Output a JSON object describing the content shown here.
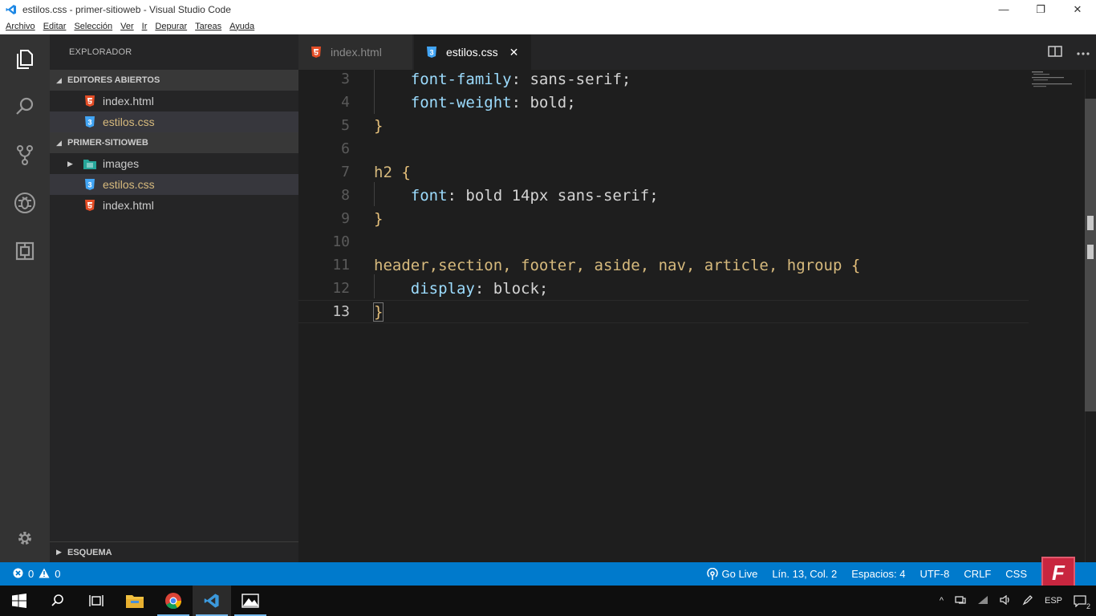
{
  "window": {
    "title": "estilos.css - primer-sitioweb - Visual Studio Code",
    "controls": {
      "minimize": "—",
      "maximize": "❐",
      "close": "✕"
    }
  },
  "menu": [
    "Archivo",
    "Editar",
    "Selección",
    "Ver",
    "Ir",
    "Depurar",
    "Tareas",
    "Ayuda"
  ],
  "activity_bar": {
    "items": [
      "explorer-icon",
      "search-icon",
      "source-control-icon",
      "debug-icon",
      "extensions-icon"
    ],
    "settings": "gear-icon"
  },
  "sidebar": {
    "title": "EXPLORADOR",
    "open_editors": {
      "label": "EDITORES ABIERTOS",
      "items": [
        {
          "name": "index.html",
          "type": "html"
        },
        {
          "name": "estilos.css",
          "type": "css"
        }
      ]
    },
    "project": {
      "label": "PRIMER-SITIOWEB",
      "items": [
        {
          "name": "images",
          "type": "folder"
        },
        {
          "name": "estilos.css",
          "type": "css"
        },
        {
          "name": "index.html",
          "type": "html"
        }
      ]
    },
    "outline": {
      "label": "ESQUEMA"
    }
  },
  "tabs": [
    {
      "label": "index.html",
      "type": "html",
      "active": false
    },
    {
      "label": "estilos.css",
      "type": "css",
      "active": true,
      "close": "✕"
    }
  ],
  "editor": {
    "lines": [
      {
        "n": "3",
        "indent": "    ",
        "prop": "font-family",
        "rest": ": sans-serif;"
      },
      {
        "n": "4",
        "indent": "    ",
        "prop": "font-weight",
        "rest": ": bold;"
      },
      {
        "n": "5",
        "brace": "}"
      },
      {
        "n": "6"
      },
      {
        "n": "7",
        "selector": "h2 ",
        "brace": "{"
      },
      {
        "n": "8",
        "indent": "    ",
        "prop": "font",
        "rest": ": bold 14px sans-serif;"
      },
      {
        "n": "9",
        "brace": "}"
      },
      {
        "n": "10"
      },
      {
        "n": "11",
        "selector": "header,section, footer, aside, nav, article, hgroup ",
        "brace": "{"
      },
      {
        "n": "12",
        "indent": "    ",
        "prop": "display",
        "rest": ": block;"
      },
      {
        "n": "13",
        "brace": "}",
        "current": true
      }
    ]
  },
  "statusbar": {
    "errors": "0",
    "warnings": "0",
    "go_live": "Go Live",
    "position": "Lín. 13, Col. 2",
    "spaces": "Espacios: 4",
    "encoding": "UTF-8",
    "eol": "CRLF",
    "language": "CSS",
    "brand": "F"
  },
  "taskbar": {
    "apps": [
      "windows-start-icon",
      "search-icon",
      "task-view-icon",
      "file-explorer-icon",
      "chrome-icon",
      "vscode-icon",
      "photos-icon"
    ],
    "tray": {
      "lang": "ESP",
      "notifications": "2"
    }
  },
  "colors": {
    "accent": "#007acc",
    "html_icon": "#e44d26",
    "css_icon": "#42a5f5",
    "property": "#9cdcfe",
    "selector": "#d7ba7d"
  }
}
